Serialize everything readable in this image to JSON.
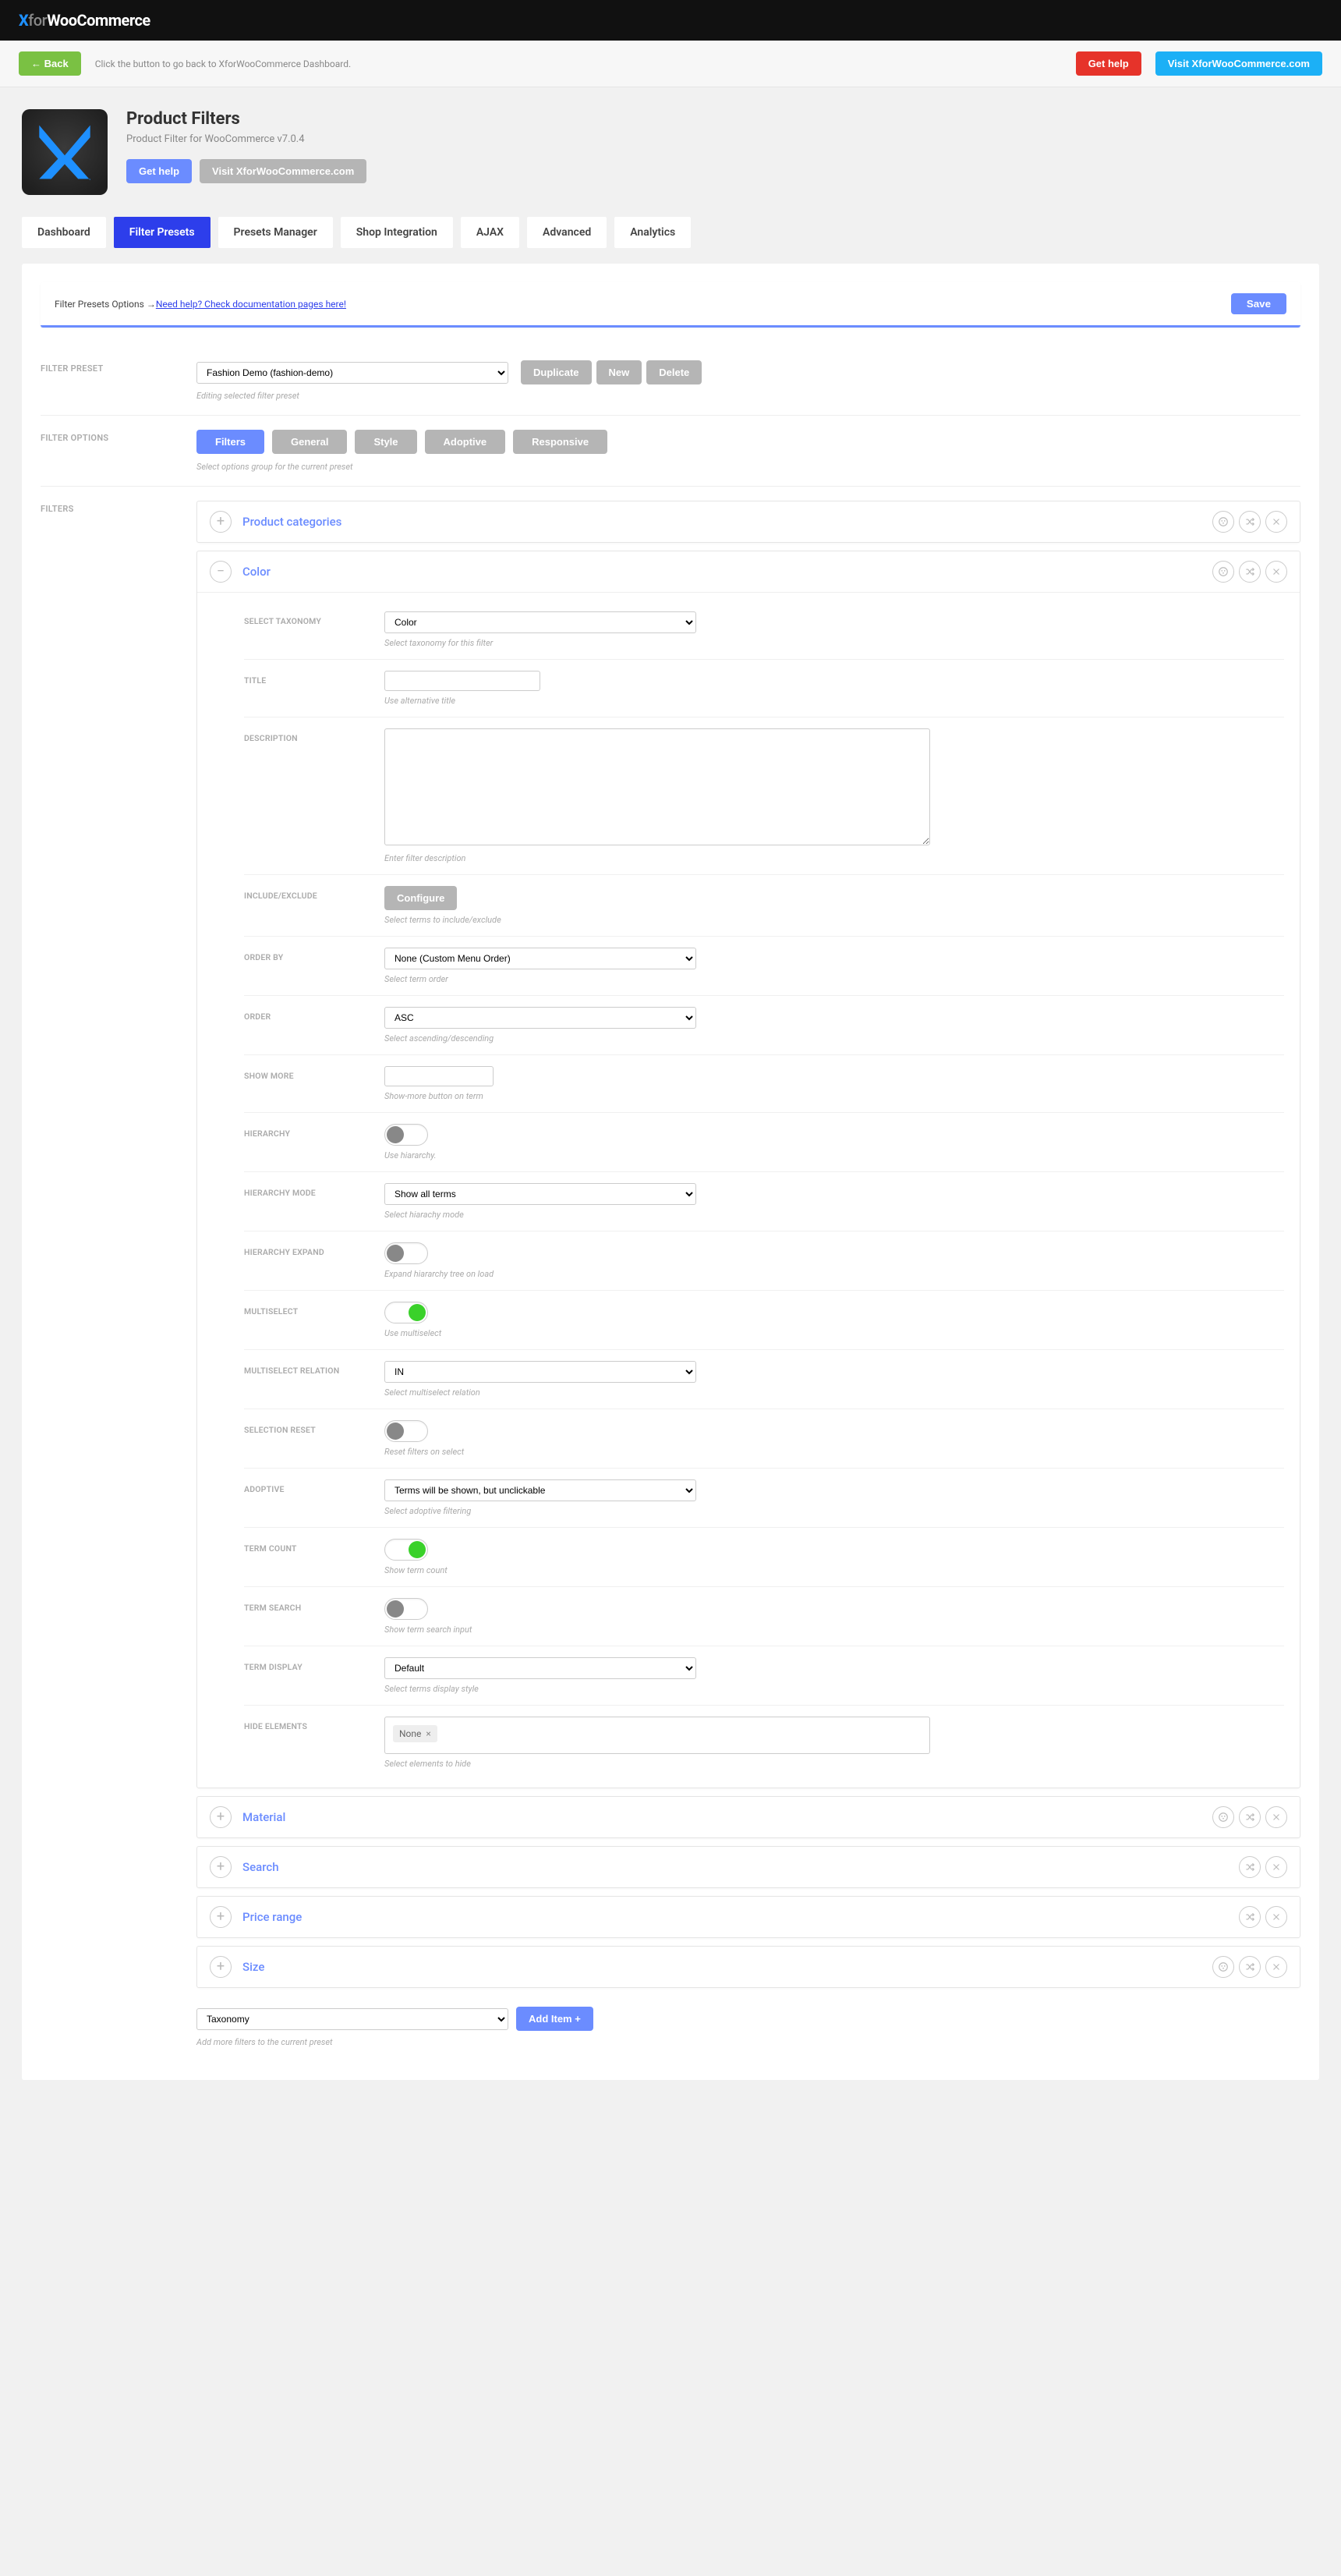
{
  "brand": {
    "x": "X",
    "for": "for",
    "name": "WooCommerce"
  },
  "actionbar": {
    "back": "← Back",
    "hint": "Click the button to go back to XforWooCommerce Dashboard.",
    "get_help": "Get help",
    "visit": "Visit XforWooCommerce.com"
  },
  "pagehead": {
    "title": "Product Filters",
    "sub": "Product Filter for WooCommerce v7.0.4",
    "get_help": "Get help",
    "visit": "Visit XforWooCommerce.com"
  },
  "tabs": [
    "Dashboard",
    "Filter Presets",
    "Presets Manager",
    "Shop Integration",
    "AJAX",
    "Advanced",
    "Analytics"
  ],
  "active_tab": 1,
  "notice": {
    "prefix": "Filter Presets Options → ",
    "link": "Need help? Check documentation pages here!",
    "save": "Save"
  },
  "sections": {
    "filter_preset": {
      "label": "FILTER PRESET",
      "select_value": "Fashion Demo (fashion-demo)",
      "buttons": [
        "Duplicate",
        "New",
        "Delete"
      ],
      "hint": "Editing selected filter preset"
    },
    "filter_options": {
      "label": "FILTER OPTIONS",
      "pills": [
        "Filters",
        "General",
        "Style",
        "Adoptive",
        "Responsive"
      ],
      "active_pill": 0,
      "hint": "Select options group for the current preset"
    },
    "filters": {
      "label": "FILTERS"
    }
  },
  "filters": [
    {
      "title": "Product categories",
      "expanded": false,
      "actions": [
        "color",
        "shuffle",
        "close"
      ]
    },
    {
      "title": "Color",
      "expanded": true,
      "actions": [
        "color",
        "shuffle",
        "close"
      ],
      "fields": [
        {
          "label": "SELECT TAXONOMY",
          "type": "select",
          "value": "Color",
          "hint": "Select taxonomy for this filter"
        },
        {
          "label": "TITLE",
          "type": "text",
          "value": "",
          "hint": "Use alternative title"
        },
        {
          "label": "DESCRIPTION",
          "type": "textarea",
          "value": "",
          "hint": "Enter filter description"
        },
        {
          "label": "INCLUDE/EXCLUDE",
          "type": "button",
          "value": "Configure",
          "hint": "Select terms to include/exclude"
        },
        {
          "label": "ORDER BY",
          "type": "select",
          "value": "None (Custom Menu Order)",
          "hint": "Select term order"
        },
        {
          "label": "ORDER",
          "type": "select",
          "value": "ASC",
          "hint": "Select ascending/descending"
        },
        {
          "label": "SHOW MORE",
          "type": "text_sm",
          "value": "",
          "hint": "Show-more button on term"
        },
        {
          "label": "HIERARCHY",
          "type": "toggle",
          "value": false,
          "hint": "Use hiararchy."
        },
        {
          "label": "HIERARCHY MODE",
          "type": "select",
          "value": "Show all terms",
          "hint": "Select hiarachy mode"
        },
        {
          "label": "HIERARCHY EXPAND",
          "type": "toggle",
          "value": false,
          "hint": "Expand hiararchy tree on load"
        },
        {
          "label": "MULTISELECT",
          "type": "toggle",
          "value": true,
          "hint": "Use multiselect"
        },
        {
          "label": "MULTISELECT RELATION",
          "type": "select",
          "value": "IN",
          "hint": "Select multiselect relation"
        },
        {
          "label": "SELECTION RESET",
          "type": "toggle",
          "value": false,
          "hint": "Reset filters on select"
        },
        {
          "label": "ADOPTIVE",
          "type": "select",
          "value": "Terms will be shown, but unclickable",
          "hint": "Select adoptive filtering"
        },
        {
          "label": "TERM COUNT",
          "type": "toggle",
          "value": true,
          "hint": "Show term count"
        },
        {
          "label": "TERM SEARCH",
          "type": "toggle",
          "value": false,
          "hint": "Show term search input"
        },
        {
          "label": "TERM DISPLAY",
          "type": "select",
          "value": "Default",
          "hint": "Select terms display style"
        },
        {
          "label": "HIDE ELEMENTS",
          "type": "tags",
          "value": [
            "None"
          ],
          "hint": "Select elements to hide"
        }
      ]
    },
    {
      "title": "Material",
      "expanded": false,
      "actions": [
        "color",
        "shuffle",
        "close"
      ]
    },
    {
      "title": "Search",
      "expanded": false,
      "actions": [
        "shuffle",
        "close"
      ]
    },
    {
      "title": "Price range",
      "expanded": false,
      "actions": [
        "shuffle",
        "close"
      ]
    },
    {
      "title": "Size",
      "expanded": false,
      "actions": [
        "color",
        "shuffle",
        "close"
      ]
    }
  ],
  "add_row": {
    "select_value": "Taxonomy",
    "button": "Add Item +",
    "hint": "Add more filters to the current preset"
  }
}
